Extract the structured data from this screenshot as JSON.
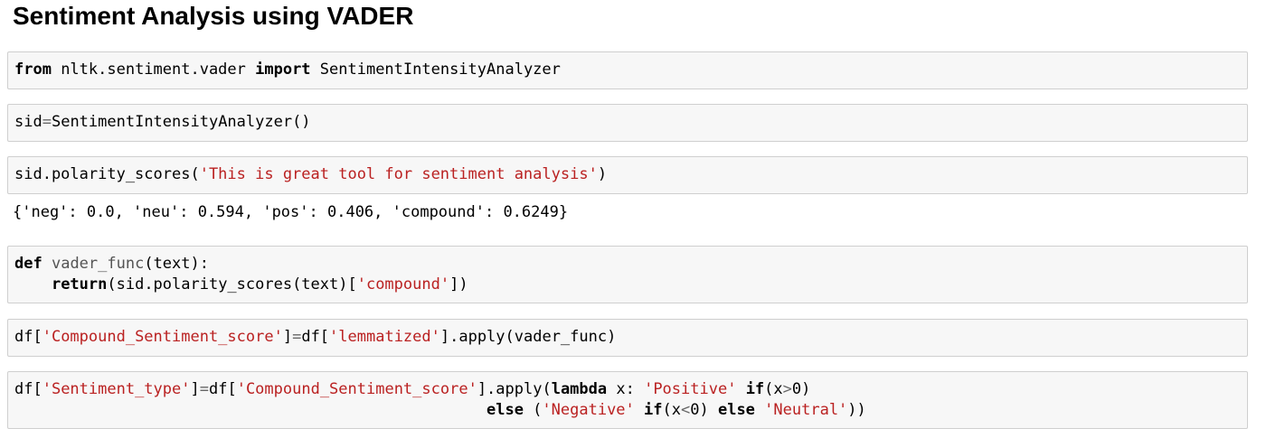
{
  "title": "Sentiment Analysis using VADER",
  "cells": {
    "c1": {
      "kw1": "from",
      "mod": " nltk.sentiment.vader ",
      "kw2": "import",
      "name": " SentimentIntensityAnalyzer"
    },
    "c2": {
      "a": "sid",
      "eq": "=",
      "b": "SentimentIntensityAnalyzer()"
    },
    "c3": {
      "a": "sid.polarity_scores(",
      "s": "'This is great tool for sentiment analysis'",
      "b": ")"
    },
    "out3": "{'neg': 0.0, 'neu': 0.594, 'pos': 0.406, 'compound': 0.6249}",
    "c4": {
      "kw_def": "def",
      "fname": "vader_func",
      "sig": "(text):",
      "indent": "    ",
      "kw_return": "return",
      "call": "(sid.polarity_scores(text)[",
      "s": "'compound'",
      "end": "])"
    },
    "c5": {
      "a": "df[",
      "s1": "'Compound_Sentiment_score'",
      "b": "]",
      "eq": "=",
      "c": "df[",
      "s2": "'lemmatized'",
      "d": "].apply(vader_func)"
    },
    "c6": {
      "a": "df[",
      "s1": "'Sentiment_type'",
      "b": "]",
      "eq": "=",
      "c": "df[",
      "s2": "'Compound_Sentiment_score'",
      "d": "].apply(",
      "kw_lambda": "lambda",
      "e": " x: ",
      "s3": "'Positive'",
      "f": " ",
      "kw_if1": "if",
      "g": "(x",
      "gt": ">",
      "h": "0)",
      "pad2": "                                                   ",
      "kw_else1": "else",
      "i": " (",
      "s4": "'Negative'",
      "j": " ",
      "kw_if2": "if",
      "k": "(x",
      "lt": "<",
      "l": "0) ",
      "kw_else2": "else",
      "m": " ",
      "s5": "'Neutral'",
      "n": "))"
    }
  }
}
